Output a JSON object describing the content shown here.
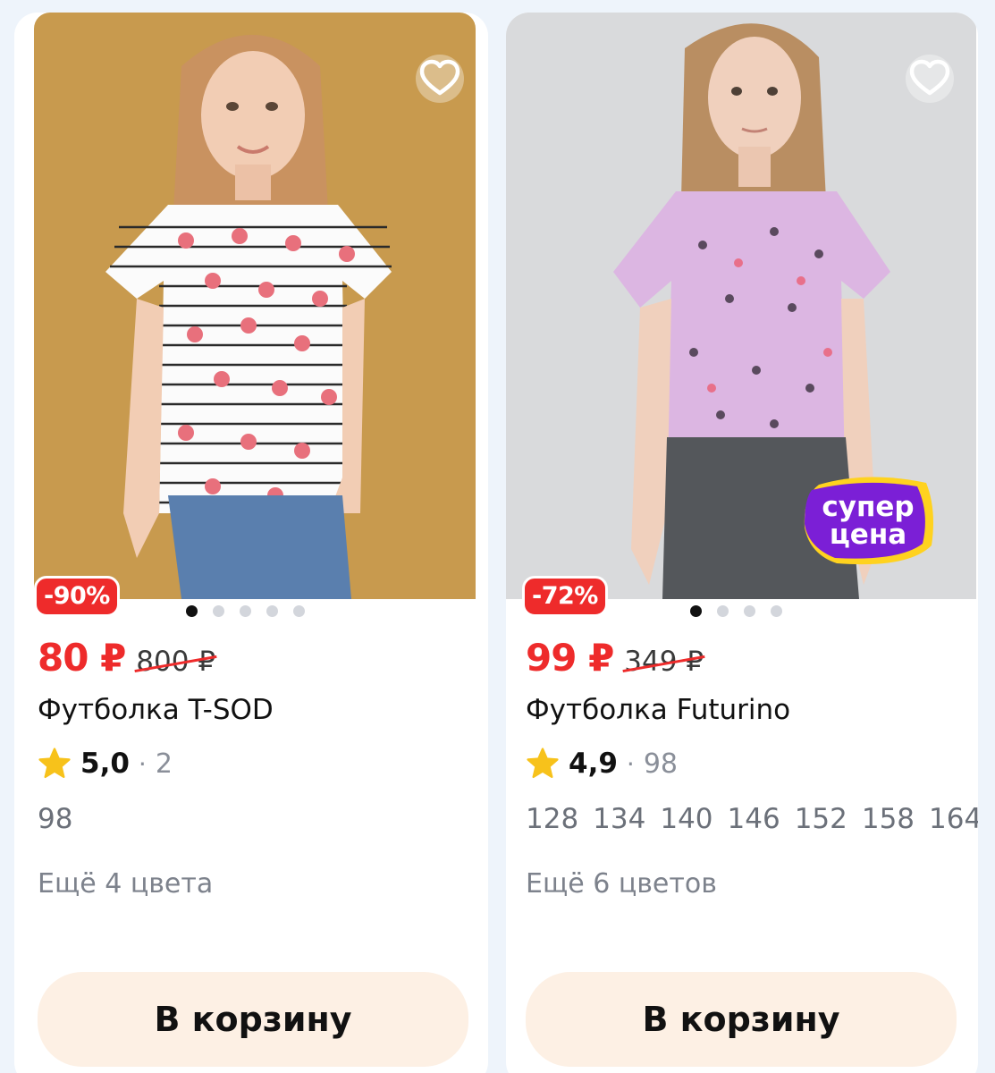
{
  "products": [
    {
      "discount": "-90%",
      "price_now": "80 ₽",
      "price_old": "800 ₽",
      "title": "Футболка T-SOD",
      "rating": "5,0",
      "rating_sep": "·",
      "reviews": "2",
      "sizes": [
        "98"
      ],
      "more_colors": "Ещё 4 цвета",
      "cart_label": "В корзину",
      "photo_bg": "#c89a4e",
      "photo_count": 5,
      "active_photo": 0
    },
    {
      "discount": "-72%",
      "price_now": "99 ₽",
      "price_old": "349 ₽",
      "title": "Футболка Futurino",
      "rating": "4,9",
      "rating_sep": "·",
      "reviews": "98",
      "sizes": [
        "128",
        "134",
        "140",
        "146",
        "152",
        "158",
        "164"
      ],
      "more_colors": "Ещё 6 цветов",
      "cart_label": "В корзину",
      "photo_bg": "#d9dadc",
      "photo_count": 4,
      "active_photo": 0,
      "promo_badge": {
        "line1": "супер",
        "line2": "цена"
      }
    }
  ],
  "colors": {
    "accent_red": "#ee2b2b",
    "star": "#f7c21b",
    "cart_button_bg": "#fdf0e4",
    "promo_purple": "#7b1fd6",
    "promo_yellow": "#ffd21f"
  },
  "icons": {
    "favorite": "heart-outline-icon",
    "rating": "star-icon"
  }
}
